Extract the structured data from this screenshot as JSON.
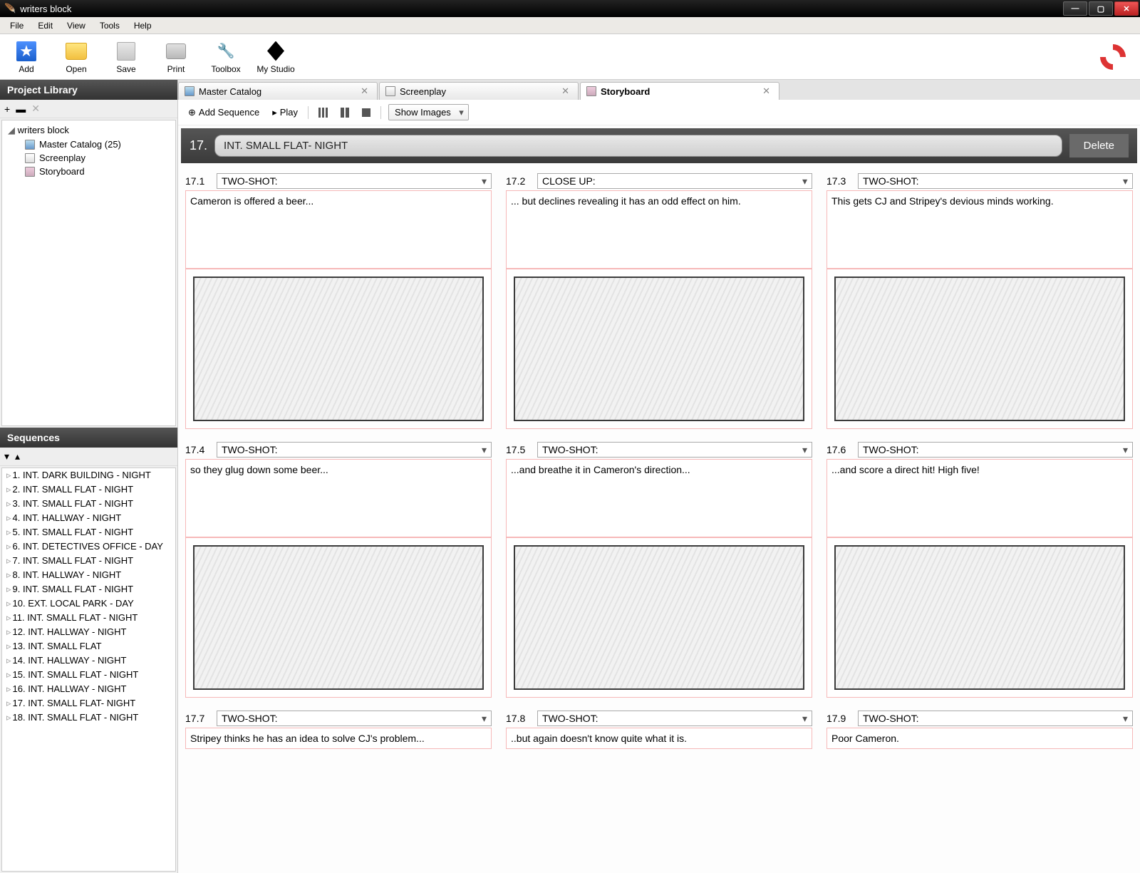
{
  "window": {
    "title": "writers block"
  },
  "menu": {
    "items": [
      "File",
      "Edit",
      "View",
      "Tools",
      "Help"
    ]
  },
  "toolbar": {
    "add": "Add",
    "open": "Open",
    "save": "Save",
    "print": "Print",
    "toolbox": "Toolbox",
    "mystudio": "My Studio"
  },
  "project_library": {
    "title": "Project Library",
    "root": "writers block",
    "items": [
      {
        "label": "Master Catalog (25)",
        "kind": "catalog"
      },
      {
        "label": "Screenplay",
        "kind": "doc"
      },
      {
        "label": "Storyboard",
        "kind": "board"
      }
    ]
  },
  "sequences": {
    "title": "Sequences",
    "items": [
      "1. INT. DARK BUILDING - NIGHT",
      "2. INT. SMALL FLAT - NIGHT",
      "3. INT. SMALL FLAT - NIGHT",
      "4. INT. HALLWAY - NIGHT",
      "5. INT. SMALL FLAT - NIGHT",
      "6. INT. DETECTIVES OFFICE - DAY",
      "7. INT. SMALL FLAT - NIGHT",
      "8. INT. HALLWAY - NIGHT",
      "9. INT. SMALL FLAT - NIGHT",
      "10. EXT. LOCAL PARK - DAY",
      "11. INT. SMALL FLAT - NIGHT",
      "12. INT. HALLWAY - NIGHT",
      "13. INT. SMALL FLAT",
      "14. INT. HALLWAY - NIGHT",
      "15. INT. SMALL FLAT - NIGHT",
      "16. INT. HALLWAY - NIGHT",
      "17. INT. SMALL FLAT- NIGHT",
      "18. INT. SMALL FLAT - NIGHT"
    ]
  },
  "tabs": [
    {
      "label": "Master Catalog",
      "active": false
    },
    {
      "label": "Screenplay",
      "active": false
    },
    {
      "label": "Storyboard",
      "active": true
    }
  ],
  "storyboard_toolbar": {
    "add_sequence": "Add Sequence",
    "play": "Play",
    "show_images": "Show Images"
  },
  "scene": {
    "number": "17.",
    "title": "INT. SMALL FLAT- NIGHT",
    "delete": "Delete"
  },
  "panels": [
    {
      "num": "17.1",
      "shot": "TWO-SHOT:",
      "desc": "Cameron is offered a beer...",
      "img": true
    },
    {
      "num": "17.2",
      "shot": "CLOSE UP:",
      "desc": "... but declines revealing it has an odd effect on him.",
      "img": true
    },
    {
      "num": "17.3",
      "shot": "TWO-SHOT:",
      "desc": "This gets CJ and Stripey's devious minds working.",
      "img": true
    },
    {
      "num": "17.4",
      "shot": "TWO-SHOT:",
      "desc": "so they glug down some beer...",
      "img": true
    },
    {
      "num": "17.5",
      "shot": "TWO-SHOT:",
      "desc": "...and breathe it in Cameron's direction...",
      "img": true
    },
    {
      "num": "17.6",
      "shot": "TWO-SHOT:",
      "desc": "...and score a direct hit! High five!",
      "img": true
    },
    {
      "num": "17.7",
      "shot": "TWO-SHOT:",
      "desc": "Stripey thinks he has an idea to solve CJ's problem...",
      "img": false
    },
    {
      "num": "17.8",
      "shot": "TWO-SHOT:",
      "desc": "..but again doesn't know quite what it is.",
      "img": false
    },
    {
      "num": "17.9",
      "shot": "TWO-SHOT:",
      "desc": "Poor Cameron.",
      "img": false
    }
  ]
}
